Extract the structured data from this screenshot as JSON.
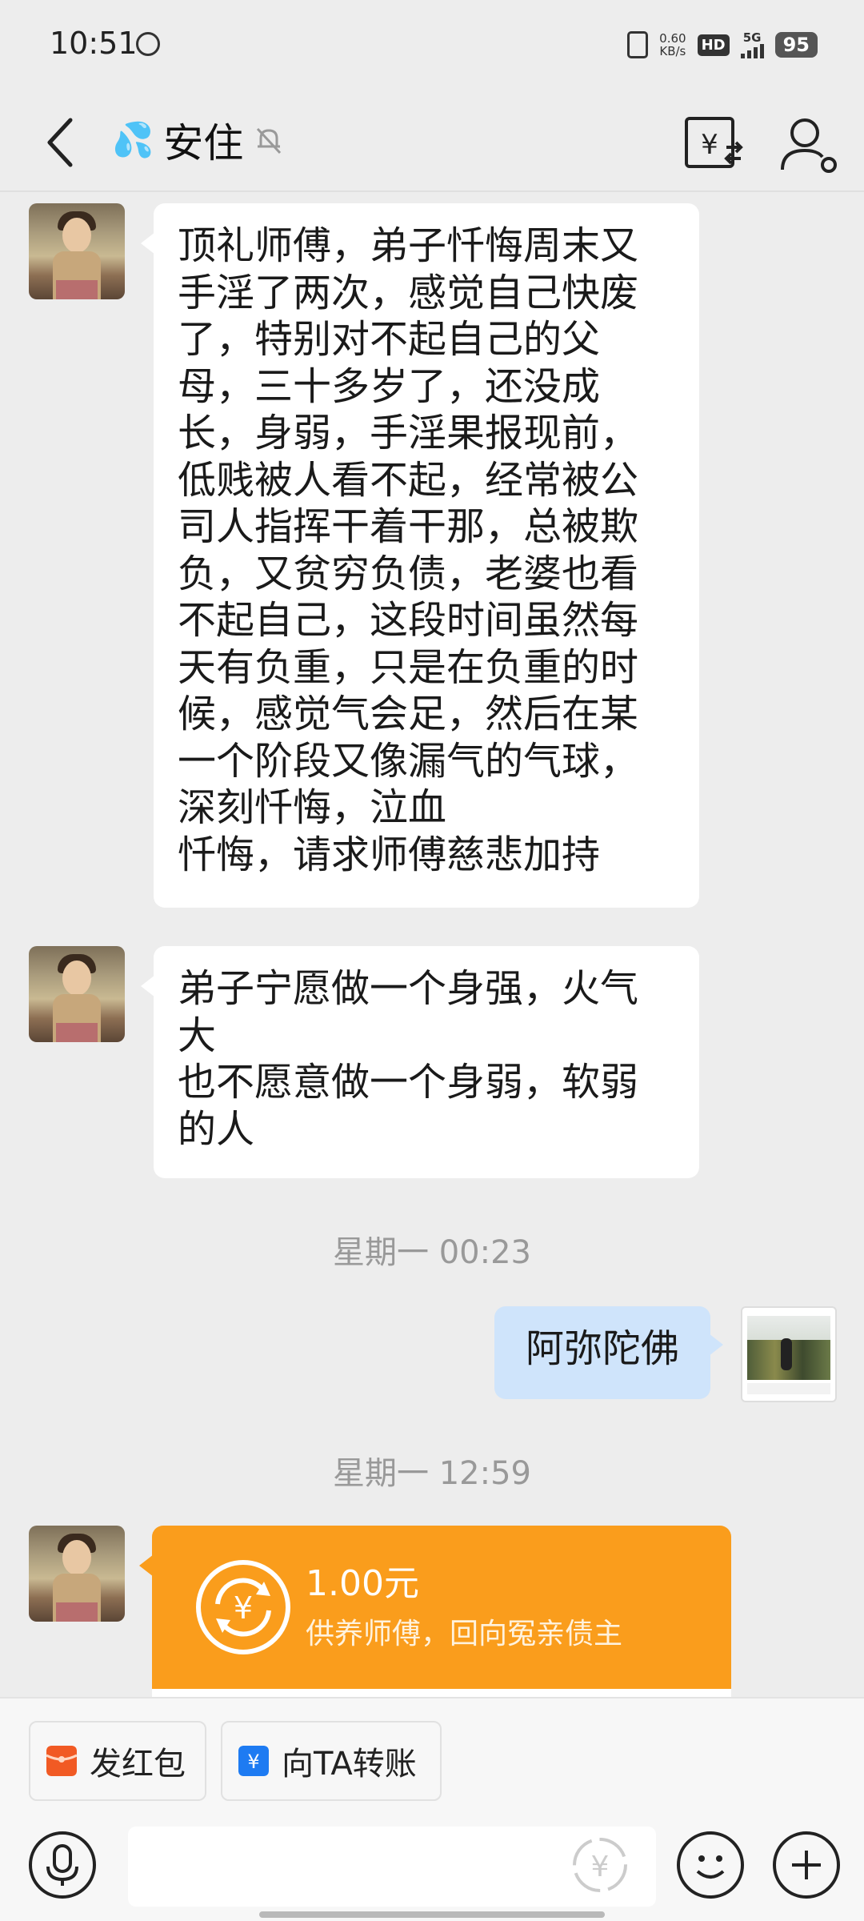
{
  "status_bar": {
    "time": "10:51",
    "net_speed_value": "0.60",
    "net_speed_unit": "KB/s",
    "hd_label": "HD",
    "network_type": "5G",
    "battery": "95"
  },
  "header": {
    "title": "安住",
    "title_emoji": "💦"
  },
  "messages": [
    {
      "side": "left",
      "text": "顶礼师傅，弟子忏悔周末又\n手淫了两次，感觉自己快废\n了，特别对不起自己的父\n母，三十多岁了，还没成\n长，身弱，手淫果报现前，\n低贱被人看不起，经常被公\n司人指挥干着干那，总被欺\n负，又贫穷负债，老婆也看\n不起自己，这段时间虽然每\n天有负重，只是在负重的时\n候，感觉气会足，然后在某\n一个阶段又像漏气的气球，\n深刻忏悔，泣血\n忏悔，请求师傅慈悲加持"
    },
    {
      "side": "left",
      "text": "弟子宁愿做一个身强，火气\n大\n也不愿意做一个身弱，软弱\n的人"
    },
    {
      "side": "right",
      "text": "阿弥陀佛"
    }
  ],
  "timestamps": [
    "星期一 00:23",
    "星期一 12:59"
  ],
  "transfer": {
    "amount": "1.00元",
    "note": "供养师傅，回向冤亲债主"
  },
  "quick_actions": [
    {
      "label": "发红包",
      "color": "#f15a24"
    },
    {
      "label": "向TA转账",
      "color": "#1e7bf2"
    }
  ],
  "input": {
    "value": "",
    "placeholder": ""
  },
  "colors": {
    "background": "#ededed",
    "transfer_orange": "#fa9d1c",
    "my_bubble": "#cfe4fb"
  }
}
